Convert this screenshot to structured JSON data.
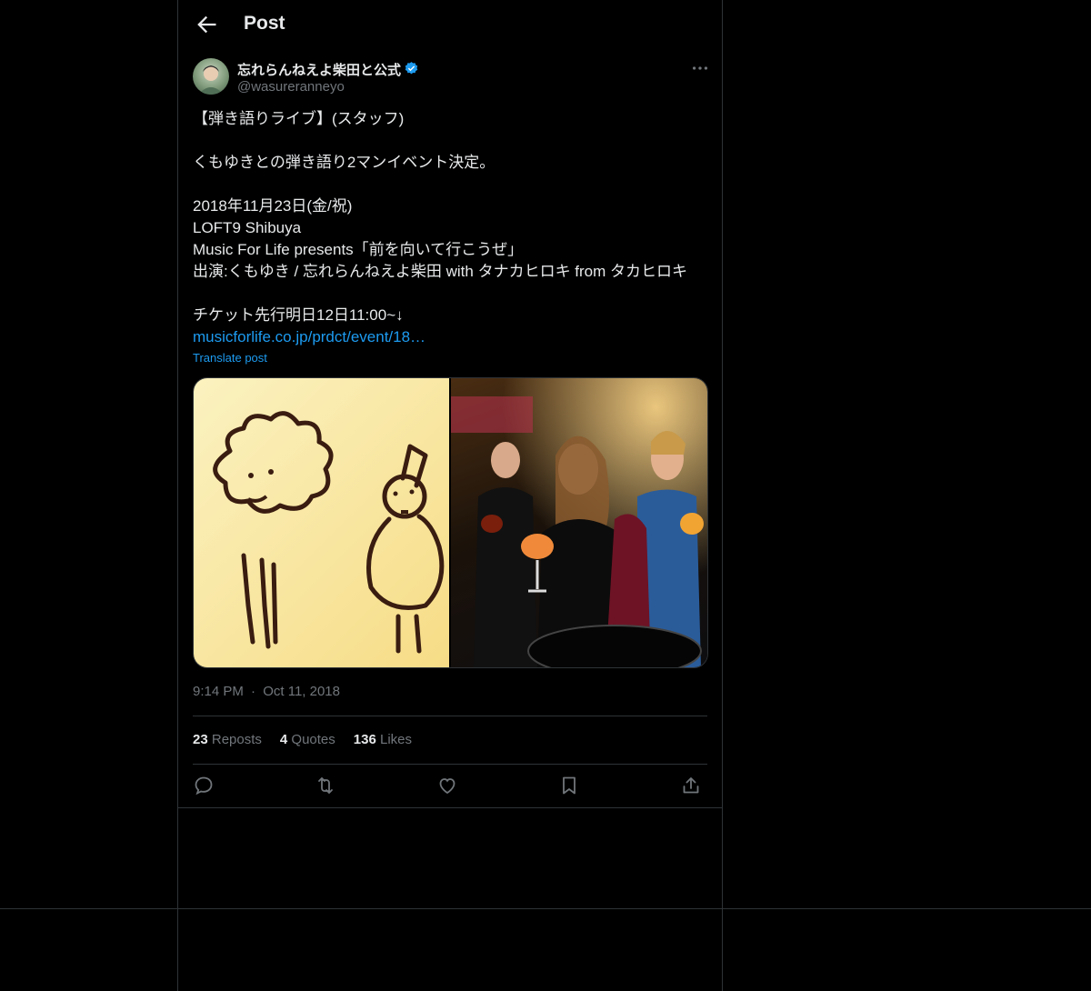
{
  "header": {
    "title": "Post",
    "back_icon": "arrow-left-icon"
  },
  "author": {
    "name": "忘れらんねえよ柴田と公式",
    "handle": "@wasureranneyo",
    "verified_color": "#1d9bf0"
  },
  "post": {
    "lines": [
      "【弾き語りライブ】(スタッフ)",
      "",
      "くもゆきとの弾き語り2マンイベント決定。",
      "",
      "2018年11月23日(金/祝)",
      "LOFT9 Shibuya",
      "Music For Life presents「前を向いて行こうぜ」",
      "出演:くもゆき / 忘れらんねえよ柴田 with タナカヒロキ from タカヒロキ",
      "",
      "チケット先行明日12日11:00~↓"
    ],
    "link": "musicforlife.co.jp/prdct/event/18…",
    "translate": "Translate post",
    "time": "9:14 PM",
    "dot": "·",
    "date": "Oct 11, 2018"
  },
  "stats": {
    "reposts_count": "23",
    "reposts_label": "Reposts",
    "quotes_count": "4",
    "quotes_label": "Quotes",
    "likes_count": "136",
    "likes_label": "Likes"
  },
  "colors": {
    "background": "#000000",
    "text": "#e7e9ea",
    "muted": "#71767b",
    "accent": "#1d9bf0",
    "border": "#2f3336"
  },
  "icons": [
    "arrow-left-icon",
    "verified-badge-icon",
    "more-icon",
    "reply-icon",
    "repost-icon",
    "like-icon",
    "bookmark-icon",
    "share-icon"
  ]
}
